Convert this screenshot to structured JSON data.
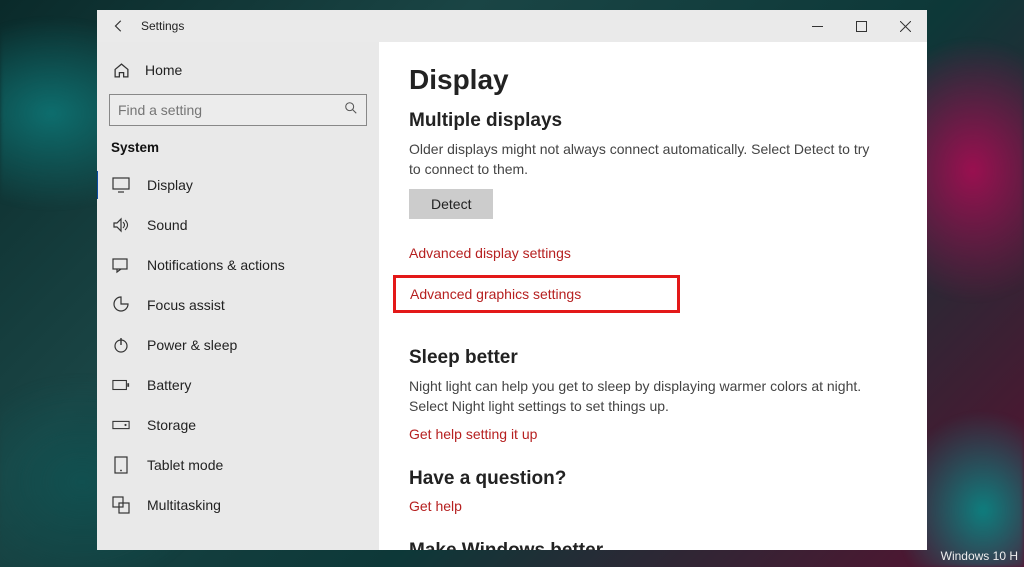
{
  "titlebar": {
    "title": "Settings"
  },
  "sidebar": {
    "home_label": "Home",
    "search_placeholder": "Find a setting",
    "category": "System",
    "items": [
      {
        "label": "Display"
      },
      {
        "label": "Sound"
      },
      {
        "label": "Notifications & actions"
      },
      {
        "label": "Focus assist"
      },
      {
        "label": "Power & sleep"
      },
      {
        "label": "Battery"
      },
      {
        "label": "Storage"
      },
      {
        "label": "Tablet mode"
      },
      {
        "label": "Multitasking"
      }
    ]
  },
  "content": {
    "page_title": "Display",
    "sect_multi": "Multiple displays",
    "multi_desc": "Older displays might not always connect automatically. Select Detect to try to connect to them.",
    "detect_btn": "Detect",
    "link_adv_display": "Advanced display settings",
    "link_adv_graphics": "Advanced graphics settings",
    "sect_sleep": "Sleep better",
    "sleep_desc": "Night light can help you get to sleep by displaying warmer colors at night. Select Night light settings to set things up.",
    "link_sleep_help": "Get help setting it up",
    "sect_question": "Have a question?",
    "link_gethelp": "Get help",
    "sect_better": "Make Windows better"
  },
  "watermark": "Windows 10 H"
}
